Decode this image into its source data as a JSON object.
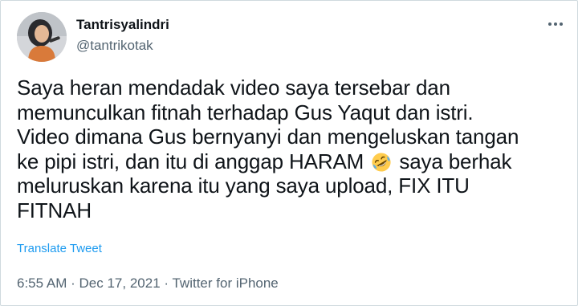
{
  "user": {
    "display_name": "Tantrisyalindri",
    "handle": "@tantrikotak",
    "avatar_icon": "profile-photo-avatar"
  },
  "tweet": {
    "lines": [
      "Saya heran mendadak video saya tersebar dan",
      "memunculkan fitnah terhadap Gus Yaqut dan istri.",
      "Video dimana Gus bernyanyi dan mengeluskan tangan",
      "ke pipi istri, dan itu di anggap HARAM",
      "saya berhak",
      "meluruskan karena itu yang saya upload, FIX ITU",
      "FITNAH"
    ],
    "emoji_icon": "rolling-on-the-floor-laughing-emoji",
    "translate_label": "Translate Tweet"
  },
  "meta": {
    "time": "6:55 AM",
    "separator": "·",
    "date": "Dec 17, 2021",
    "source": "Twitter for iPhone"
  },
  "menu_icon": "more-options-icon",
  "colors": {
    "text": "#0f1419",
    "secondary": "#536471",
    "link": "#1d9bf0",
    "border": "#cfd9de"
  }
}
